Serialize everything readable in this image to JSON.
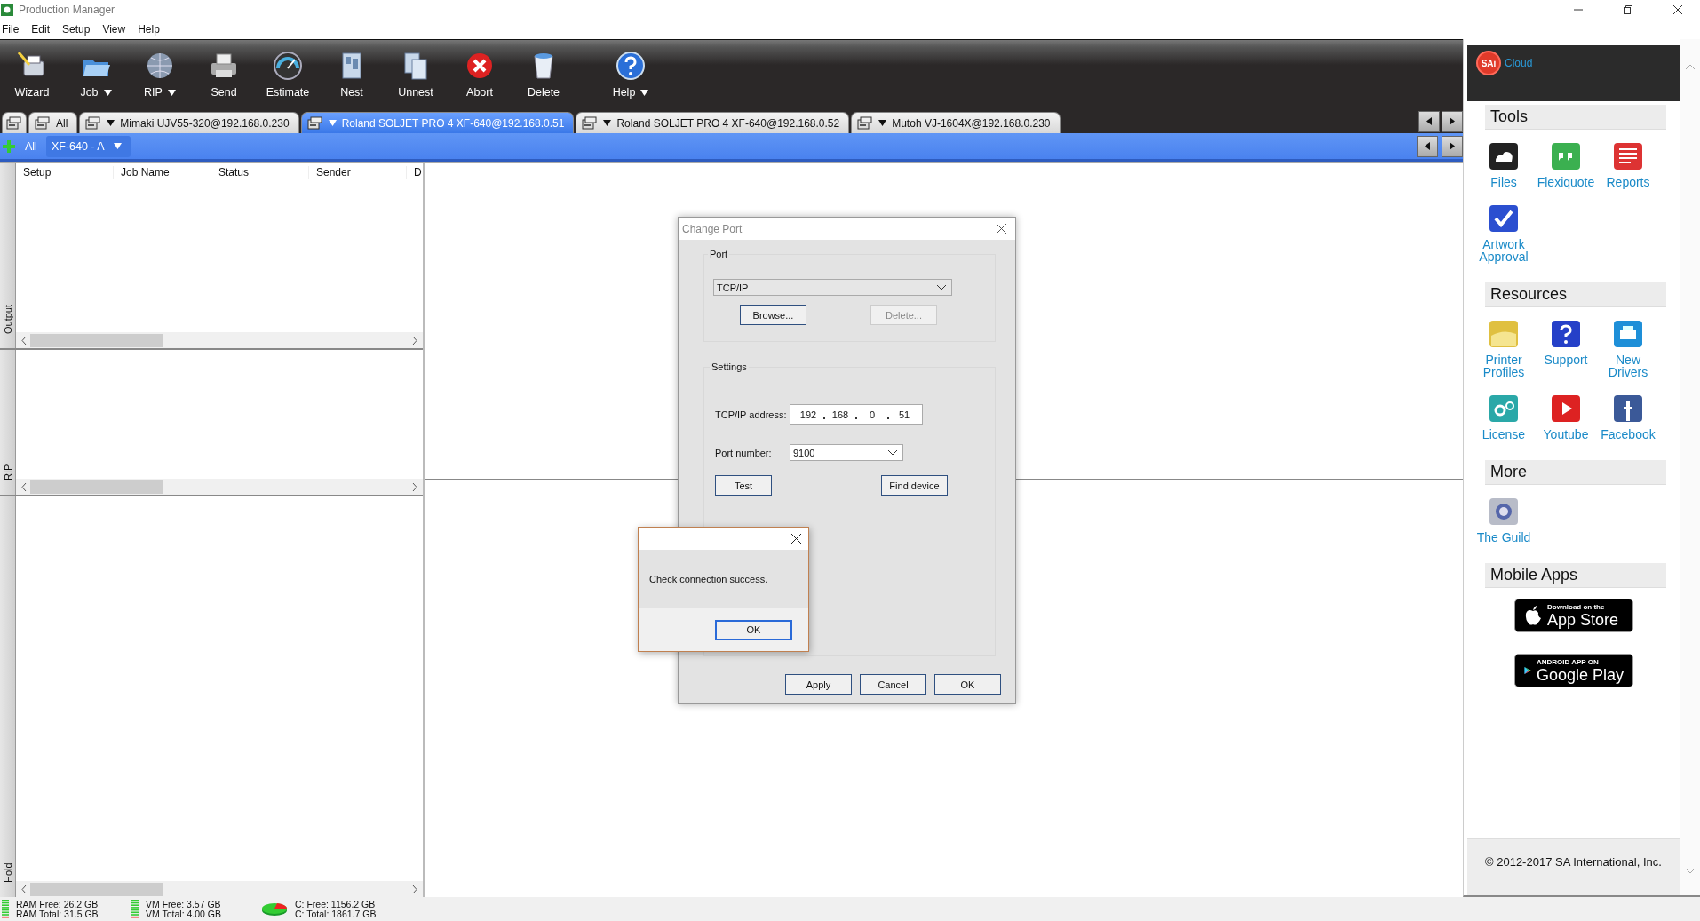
{
  "window": {
    "title": "Production Manager"
  },
  "menu": [
    "File",
    "Edit",
    "Setup",
    "View",
    "Help"
  ],
  "toolbar": [
    {
      "label": "Wizard",
      "dropdown": false
    },
    {
      "label": "Job",
      "dropdown": true
    },
    {
      "label": "RIP",
      "dropdown": true
    },
    {
      "label": "Send",
      "dropdown": false
    },
    {
      "label": "Estimate",
      "dropdown": false
    },
    {
      "label": "Nest",
      "dropdown": false
    },
    {
      "label": "Unnest",
      "dropdown": false
    },
    {
      "label": "Abort",
      "dropdown": false
    },
    {
      "label": "Delete",
      "dropdown": false
    },
    {
      "label": "Help",
      "dropdown": true
    }
  ],
  "printer_tabs": [
    {
      "label": "All",
      "selected": false,
      "dropdown": false
    },
    {
      "label": "Mimaki UJV55-320@192.168.0.230",
      "selected": false,
      "dropdown": true
    },
    {
      "label": "Roland SOLJET PRO 4 XF-640@192.168.0.51",
      "selected": true,
      "dropdown": true
    },
    {
      "label": "Roland SOLJET PRO 4 XF-640@192.168.0.52",
      "selected": false,
      "dropdown": true
    },
    {
      "label": "Mutoh VJ-1604X@192.168.0.230",
      "selected": false,
      "dropdown": true
    }
  ],
  "queue_tabs": [
    {
      "label": "All",
      "selected": false,
      "dropdown": false
    },
    {
      "label": "XF-640 - A",
      "selected": true,
      "dropdown": true
    }
  ],
  "side_tabs": [
    "Output",
    "RIP",
    "Hold"
  ],
  "job_table": {
    "columns": [
      "Setup",
      "Job Name",
      "Status",
      "Sender",
      "D"
    ]
  },
  "change_port_dialog": {
    "title": "Change Port",
    "port_group": "Port",
    "port_type": "TCP/IP",
    "port_buttons": [
      {
        "label": "Browse...",
        "disabled": false
      },
      {
        "label": "Delete...",
        "disabled": true
      }
    ],
    "settings_group": "Settings",
    "ip_label": "TCP/IP address:",
    "ip_octets": [
      "192",
      "168",
      "0",
      "51"
    ],
    "port_number_label": "Port number:",
    "port_number": "9100",
    "test_button": "Test",
    "find_button": "Find device",
    "footer_buttons": [
      "Apply",
      "Cancel",
      "OK"
    ]
  },
  "message_box": {
    "text": "Check connection success.",
    "button": "OK"
  },
  "sidebar": {
    "logo_text": "SAi",
    "brand": "Cloud",
    "sections": [
      {
        "title": "Tools",
        "items": [
          "Files",
          "Flexiquote",
          "Reports",
          "Artwork Approval"
        ]
      },
      {
        "title": "Resources",
        "items": [
          "Printer Profiles",
          "Support",
          "New Drivers",
          "License",
          "Youtube",
          "Facebook"
        ]
      },
      {
        "title": "More",
        "items": [
          "The Guild"
        ]
      }
    ],
    "mobile_apps": {
      "title": "Mobile Apps",
      "badges": [
        {
          "kind": "apple",
          "top": "Download on the",
          "name": "App Store"
        },
        {
          "kind": "google",
          "top": "ANDROID APP ON",
          "name": "Google Play"
        }
      ]
    },
    "copyright": "© 2012-2017 SA International, Inc."
  },
  "status_bar": [
    {
      "kind": "meter",
      "lines": [
        "RAM Free: 26.2 GB",
        "RAM Total: 31.5 GB"
      ]
    },
    {
      "kind": "meter",
      "lines": [
        "VM Free: 3.57 GB",
        "VM Total: 4.00 GB"
      ]
    },
    {
      "kind": "disk",
      "lines": [
        "C: Free: 1156.2 GB",
        "C: Total: 1861.7 GB"
      ]
    }
  ]
}
